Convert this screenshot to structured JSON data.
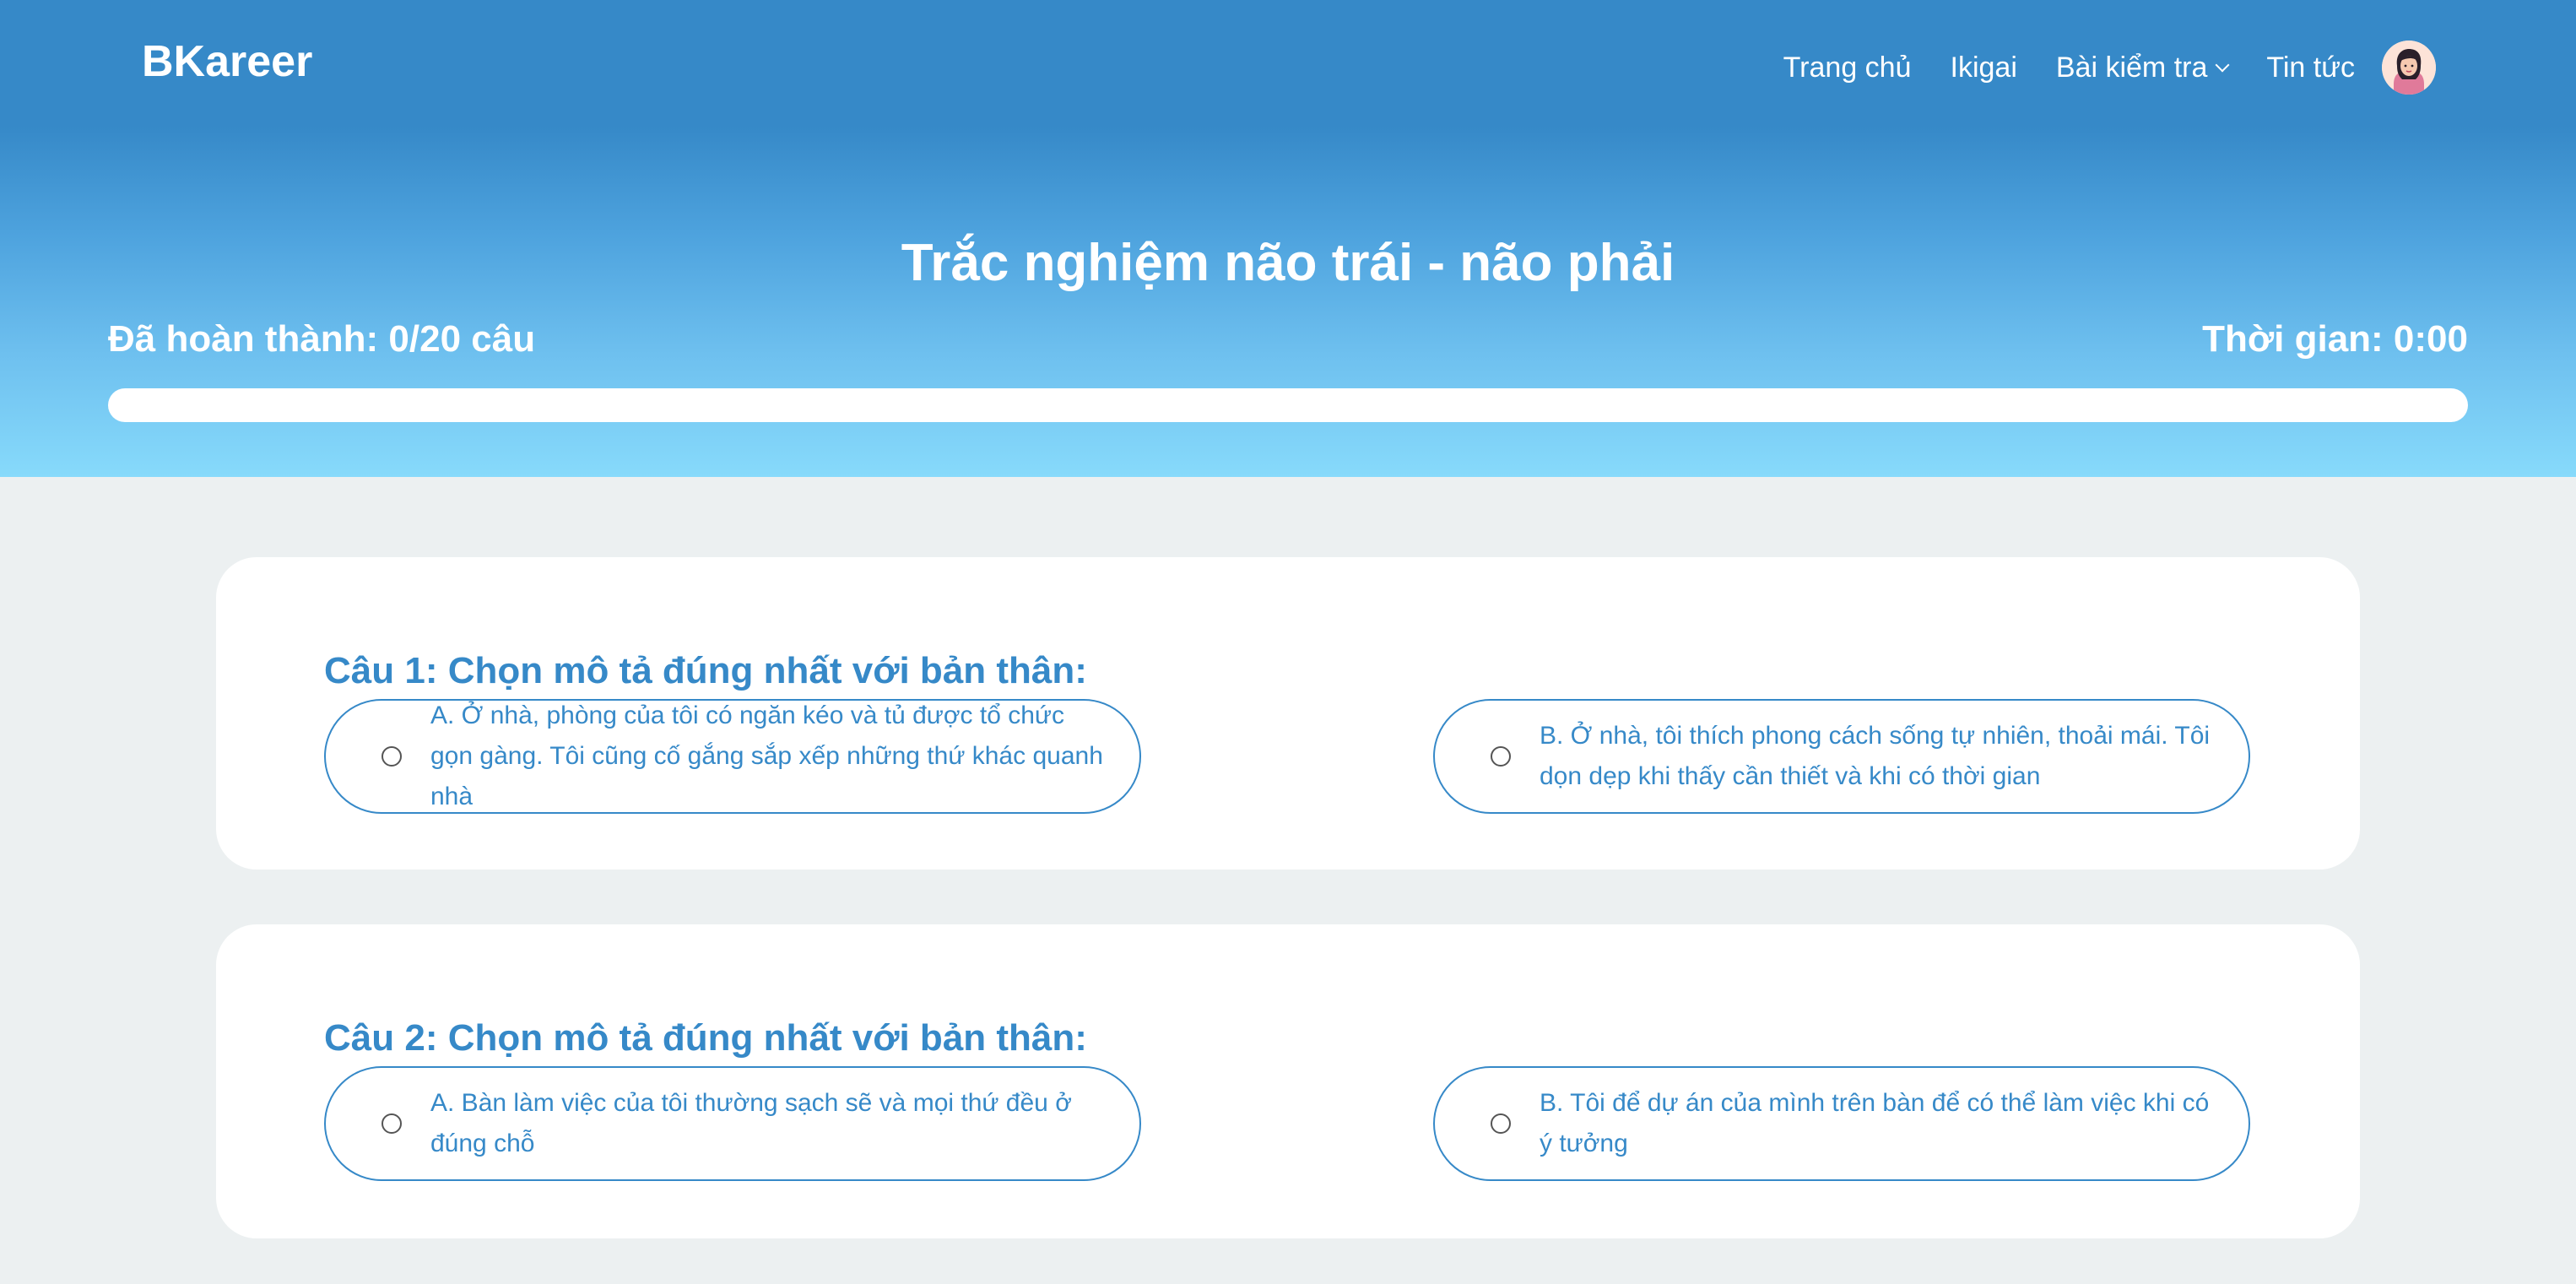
{
  "brand": "BKareer",
  "nav": {
    "items": [
      {
        "label": "Trang chủ"
      },
      {
        "label": "Ikigai"
      },
      {
        "label": "Bài kiểm tra"
      },
      {
        "label": "Tin tức"
      }
    ]
  },
  "page": {
    "title": "Trắc nghiệm não trái - não phải",
    "progress_text": "Đã hoàn thành: 0/20 câu",
    "timer_text": "Thời gian: 0:00",
    "progress_fraction": 0
  },
  "questions": [
    {
      "title": "Câu 1: Chọn mô tả đúng nhất với bản thân:",
      "options": [
        {
          "label": "A. Ở nhà, phòng của tôi có ngăn kéo và tủ được tổ chức gọn gàng. Tôi cũng cố gắng sắp xếp những thứ khác quanh nhà"
        },
        {
          "label": "B. Ở nhà, tôi thích phong cách sống tự nhiên, thoải mái. Tôi dọn dẹp khi thấy cần thiết và khi có thời gian"
        }
      ]
    },
    {
      "title": "Câu 2: Chọn mô tả đúng nhất với bản thân:",
      "options": [
        {
          "label": "A. Bàn làm việc của tôi thường sạch sẽ và mọi thứ đều ở đúng chỗ"
        },
        {
          "label": "B. Tôi để dự án của mình trên bàn để có thể làm việc khi có ý tưởng"
        }
      ]
    }
  ],
  "colors": {
    "primary": "#3689c8",
    "header_top": "#3689c8",
    "header_bottom": "#87dafb",
    "page_background": "#ecf0f1",
    "card_background": "#ffffff"
  },
  "icons": {
    "avatar": "user-avatar-icon",
    "dropdown": "chevron-down-icon",
    "radio": "radio-button-icon"
  }
}
